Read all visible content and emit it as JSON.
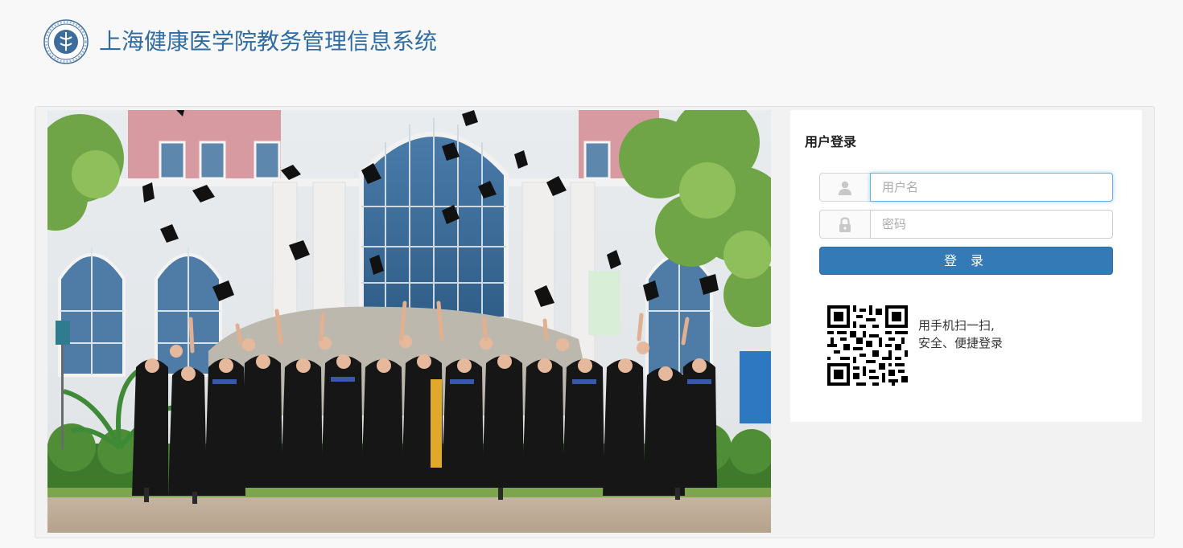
{
  "header": {
    "logo_icon": "school-seal-icon",
    "title": "上海健康医学院教务管理信息系统",
    "title_color": "#2f6ca3"
  },
  "hero": {
    "image_icon": "graduation-photo"
  },
  "login": {
    "title": "用户登录",
    "username": {
      "icon": "user-icon",
      "placeholder": "用户名",
      "value": ""
    },
    "password": {
      "icon": "lock-icon",
      "placeholder": "密码",
      "value": ""
    },
    "submit_label": "登 录",
    "button_color": "#337ab7",
    "qr_icon": "qr-code-icon",
    "qr_line1": "用手机扫一扫,",
    "qr_line2": "安全、便捷登录"
  }
}
